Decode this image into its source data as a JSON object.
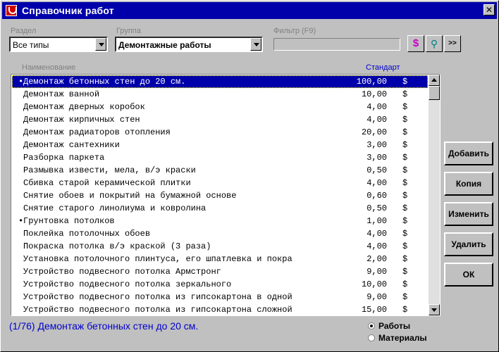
{
  "window": {
    "title": "Справочник работ"
  },
  "filters": {
    "section_label": "Раздел",
    "section_value": "Все типы",
    "group_label": "Группа",
    "group_value": "Демонтажные работы",
    "filter_label": "Фильтр (F9)",
    "filter_value": ""
  },
  "toolbar": {
    "currency_symbol": "$",
    "binoculars_symbol": "⚲",
    "more_label": ">>"
  },
  "table": {
    "col_name": "Наименование",
    "col_standard": "Стандарт",
    "rows": [
      {
        "bullet": "•",
        "name": "Демонтаж бетонных стен до 20 см.",
        "value": "100,00",
        "cur": "$"
      },
      {
        "bullet": "",
        "name": "Демонтаж ванной",
        "value": "10,00",
        "cur": "$"
      },
      {
        "bullet": "",
        "name": "Демонтаж дверных коробок",
        "value": "4,00",
        "cur": "$"
      },
      {
        "bullet": "",
        "name": "Демонтаж кирпичных стен",
        "value": "4,00",
        "cur": "$"
      },
      {
        "bullet": "",
        "name": "Демонтаж радиаторов отопления",
        "value": "20,00",
        "cur": "$"
      },
      {
        "bullet": "",
        "name": "Демонтаж сантехники",
        "value": "3,00",
        "cur": "$"
      },
      {
        "bullet": "",
        "name": "Разборка паркета",
        "value": "3,00",
        "cur": "$"
      },
      {
        "bullet": "",
        "name": "Размывка извести, мела, в/э краски",
        "value": "0,50",
        "cur": "$"
      },
      {
        "bullet": "",
        "name": "Сбивка старой керамической плитки",
        "value": "4,00",
        "cur": "$"
      },
      {
        "bullet": "",
        "name": "Снятие обоев и покрытий на бумажной основе",
        "value": "0,60",
        "cur": "$"
      },
      {
        "bullet": "",
        "name": "Снятие старого линолиума и ковролина",
        "value": "0,50",
        "cur": "$"
      },
      {
        "bullet": "•",
        "name": "Грунтовка потолков",
        "value": "1,00",
        "cur": "$"
      },
      {
        "bullet": "",
        "name": "Поклейка потолочных обоев",
        "value": "4,00",
        "cur": "$"
      },
      {
        "bullet": "",
        "name": "Покраска потолка в/э краской (3 раза)",
        "value": "4,00",
        "cur": "$"
      },
      {
        "bullet": "",
        "name": "Установка потолочного плинтуса, его шпатлевка и покра",
        "value": "2,00",
        "cur": "$"
      },
      {
        "bullet": "",
        "name": "Устройство подвесного потолка Армстронг",
        "value": "9,00",
        "cur": "$"
      },
      {
        "bullet": "",
        "name": "Устройство подвесного потолка зеркального",
        "value": "10,00",
        "cur": "$"
      },
      {
        "bullet": "",
        "name": "Устройство подвесного потолка из гипсокартона в одной",
        "value": "9,00",
        "cur": "$"
      },
      {
        "bullet": "",
        "name": "Устройство подвесного потолка из гипсокартона сложной",
        "value": "15,00",
        "cur": "$"
      }
    ]
  },
  "actions": {
    "add": "Добавить",
    "copy": "Копия",
    "edit": "Изменить",
    "delete": "Удалить",
    "ok": "ОК"
  },
  "status": {
    "text": "(1/76)  Демонтаж бетонных стен до 20 см."
  },
  "mode": {
    "works": "Работы",
    "materials": "Материалы",
    "selected": "works"
  },
  "colors": {
    "title_bg": "#0000aa",
    "selection": "#0000aa",
    "status_text": "#0000cc",
    "background": "#c0c0c0"
  }
}
